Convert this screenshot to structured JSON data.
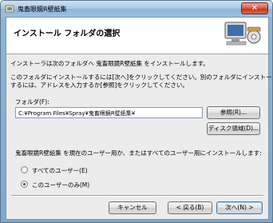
{
  "window": {
    "title": "鬼畜眼鏡R壁紙集",
    "close_label": "✕"
  },
  "header": {
    "title": "インストール フォルダの選択"
  },
  "body": {
    "intro": "インストーラは次のフォルダへ 鬼畜眼鏡R壁紙集 をインストールします。",
    "instructions_line1": "このフォルダにインストールするには[次へ]をクリックしてください。別のフォルダにインストール",
    "instructions_line2": "するには、アドレスを入力するか[参照]をクリックしてください。"
  },
  "folder": {
    "label": "フォルダ(F):",
    "value": "C:¥Program Files¥Spray¥鬼畜眼鏡R壁紙集¥",
    "browse_label": "参照(R)...",
    "disk_cost_label": "ディスク領域(D)..."
  },
  "install_for": {
    "question": "鬼畜眼鏡R壁紙集 を現在のユーザー用か、またはすべてのユーザー用にインストールします:",
    "options": [
      {
        "label": "すべてのユーザー(E)",
        "selected": false
      },
      {
        "label": "このユーザーのみ(M)",
        "selected": true
      }
    ]
  },
  "buttons": {
    "cancel": "キャンセル",
    "back": "< 戻る(B)",
    "next": "次へ(N) >"
  }
}
